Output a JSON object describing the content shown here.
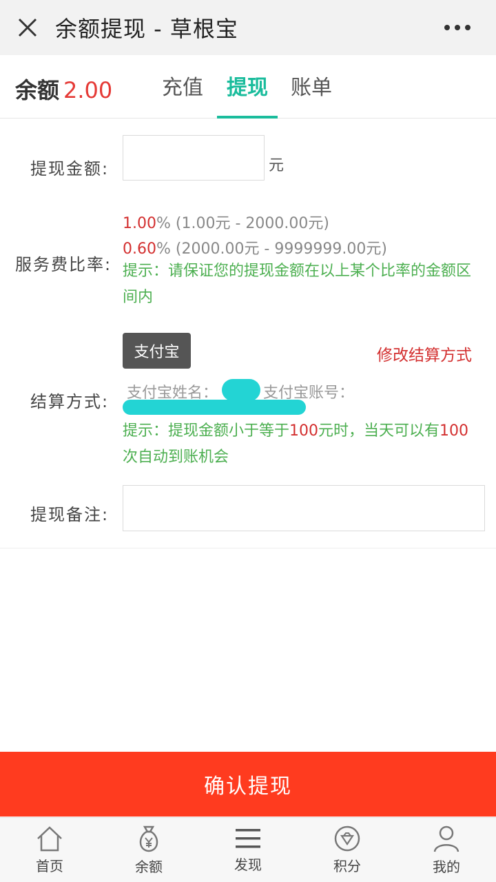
{
  "header": {
    "title": "余额提现 - 草根宝",
    "close_icon": "close-icon",
    "more_icon": "more-icon"
  },
  "balance": {
    "label": "余额",
    "amount": "2.00"
  },
  "tabs": [
    {
      "label": "充值",
      "active": false
    },
    {
      "label": "提现",
      "active": true
    },
    {
      "label": "账单",
      "active": false
    }
  ],
  "form": {
    "amount_label": "提现金额:",
    "amount_value": "",
    "amount_unit": "元",
    "fee_label": "服务费比率:",
    "fee_rates": [
      {
        "rate": "1.00",
        "suffix": "% (1.00元 - 2000.00元)"
      },
      {
        "rate": "0.60",
        "suffix": "% (2000.00元 - 9999999.00元)"
      }
    ],
    "fee_hint": "提示：请保证您的提现金额在以上某个比率的金额区间内",
    "settle_label": "结算方式:",
    "settle_method": "支付宝",
    "modify_link": "修改结算方式",
    "account_name_label": "支付宝姓名：",
    "account_no_label": "支付宝账号：",
    "settle_hint_prefix": "提示：提现金额小于等于",
    "settle_hint_num1": "100",
    "settle_hint_mid": "元时，当天可以有",
    "settle_hint_num2": "100",
    "settle_hint_suffix": "次自动到账机会",
    "remark_label": "提现备注:",
    "remark_value": ""
  },
  "confirm_button": "确认提现",
  "bottom_nav": [
    {
      "label": "首页",
      "icon": "home-icon"
    },
    {
      "label": "余额",
      "icon": "money-bag-icon"
    },
    {
      "label": "发现",
      "icon": "menu-icon"
    },
    {
      "label": "积分",
      "icon": "points-icon"
    },
    {
      "label": "我的",
      "icon": "user-icon"
    }
  ],
  "colors": {
    "accent": "#1abc9c",
    "danger": "#d32f2f",
    "hint": "#4caf50",
    "confirm": "#ff3b1f",
    "redaction": "#23d4d4"
  }
}
